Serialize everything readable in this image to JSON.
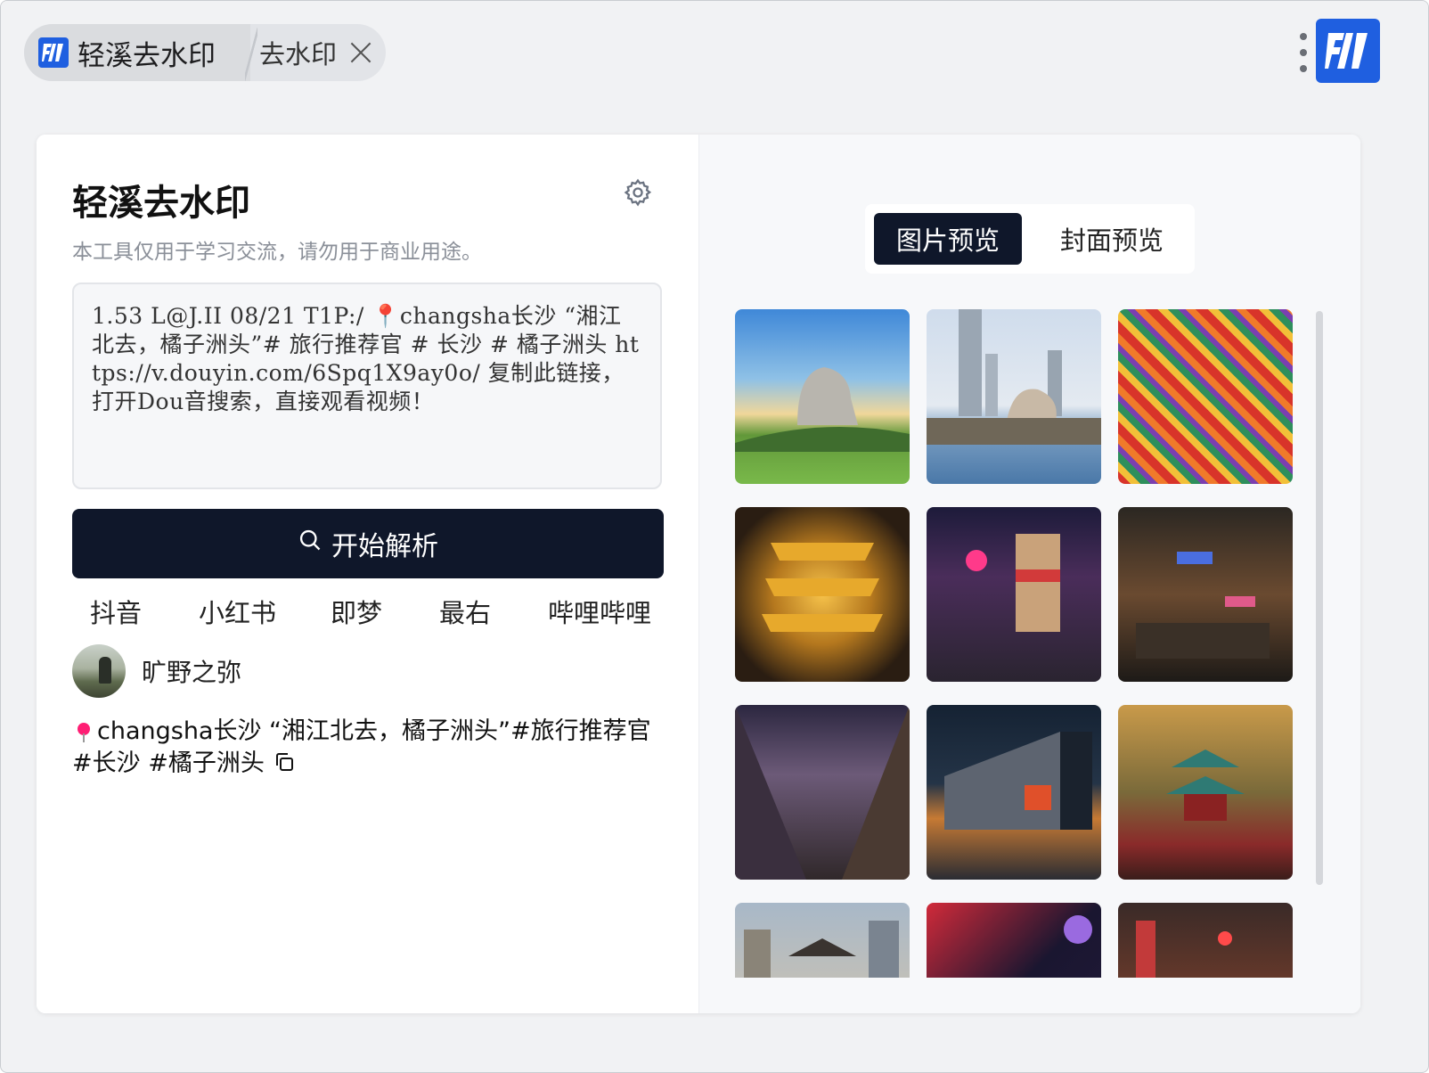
{
  "titlebar": {
    "active_tab": "轻溪去水印",
    "inactive_tab": "去水印"
  },
  "app": {
    "title": "轻溪去水印",
    "subtitle": "本工具仅用于学习交流，请勿用于商业用途。",
    "input_text": "1.53 L@J.II 08/21 T1P:/ 📍changsha长沙 “湘江北去，橘子洲头”# 旅行推荐官 # 长沙 # 橘子洲头  https://v.douyin.com/6Spq1X9ay0o/ 复制此链接，打开Dou音搜索，直接观看视频！",
    "parse_button": "开始解析",
    "platforms": [
      "抖音",
      "小红书",
      "即梦",
      "最右",
      "哔哩哔哩"
    ],
    "author_name": "旷野之弥",
    "description": "changsha长沙 “湘江北去，橘子洲头”#旅行推荐官 #长沙 #橘子洲头"
  },
  "preview": {
    "tabs": [
      "图片预览",
      "封面预览"
    ],
    "active_tab_index": 0,
    "thumbnails": [
      {
        "name": "statue-sky"
      },
      {
        "name": "city-statue-river"
      },
      {
        "name": "colorful-badges"
      },
      {
        "name": "golden-pavilion-night"
      },
      {
        "name": "neon-street-tram"
      },
      {
        "name": "night-alley"
      },
      {
        "name": "crowded-street-night"
      },
      {
        "name": "ifs-mall-night"
      },
      {
        "name": "pavilion-autumn"
      },
      {
        "name": "city-skyline-day"
      },
      {
        "name": "neon-signs"
      },
      {
        "name": "red-lantern-alley"
      }
    ]
  },
  "colors": {
    "accent_dark": "#0f172a",
    "brand_blue": "#1f5fe0",
    "pin": "#ff1e74"
  }
}
